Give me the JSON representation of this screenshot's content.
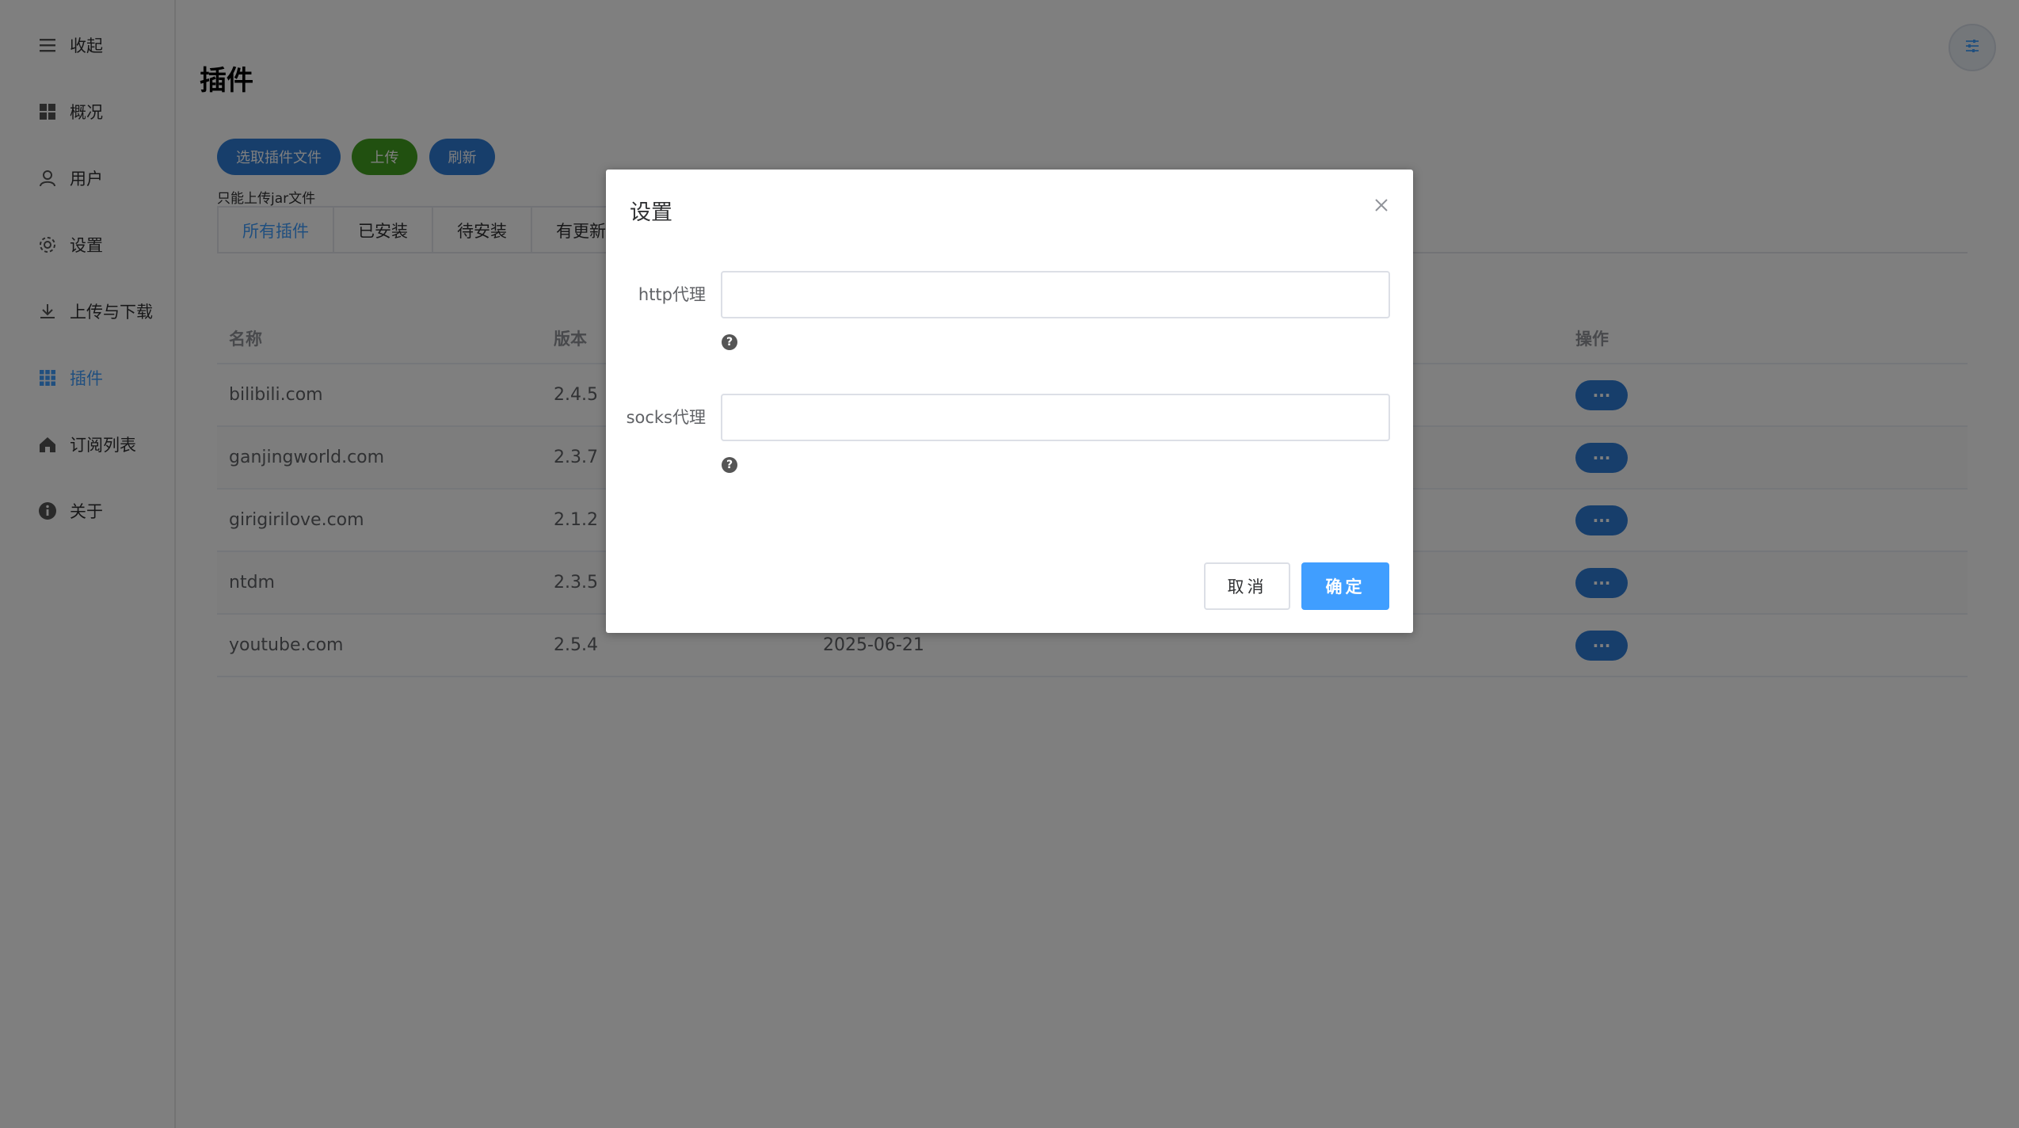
{
  "sidebar": {
    "items": [
      {
        "label": "收起",
        "icon": "menu-icon"
      },
      {
        "label": "概况",
        "icon": "dashboard-icon"
      },
      {
        "label": "用户",
        "icon": "user-icon"
      },
      {
        "label": "设置",
        "icon": "gear-icon"
      },
      {
        "label": "上传与下载",
        "icon": "download-icon"
      },
      {
        "label": "插件",
        "icon": "grid-icon",
        "active": true
      },
      {
        "label": "订阅列表",
        "icon": "home-icon"
      },
      {
        "label": "关于",
        "icon": "info-icon"
      }
    ]
  },
  "page": {
    "title": "插件",
    "select_button": "选取插件文件",
    "upload_button": "上传",
    "refresh_button": "刷新",
    "upload_hint": "只能上传jar文件"
  },
  "tabs": [
    "所有插件",
    "已安装",
    "待安装",
    "有更新"
  ],
  "table": {
    "headers": {
      "name": "名称",
      "version": "版本",
      "date": "",
      "action": "操作"
    },
    "rows": [
      {
        "name": "bilibili.com",
        "version": "2.4.5",
        "date": ""
      },
      {
        "name": "ganjingworld.com",
        "version": "2.3.7",
        "date": ""
      },
      {
        "name": "girigirilove.com",
        "version": "2.1.2",
        "date": ""
      },
      {
        "name": "ntdm",
        "version": "2.3.5",
        "date": ""
      },
      {
        "name": "youtube.com",
        "version": "2.5.4",
        "date": "2025-06-21"
      }
    ],
    "action_label": "···"
  },
  "dialog": {
    "title": "设置",
    "http_label": "http代理",
    "http_value": "",
    "socks_label": "socks代理",
    "socks_value": "",
    "help_glyph": "?",
    "cancel": "取消",
    "ok": "确定"
  },
  "colors": {
    "primary": "#409eff",
    "pill_blue": "#2f7dd6",
    "pill_green": "#42a020"
  }
}
